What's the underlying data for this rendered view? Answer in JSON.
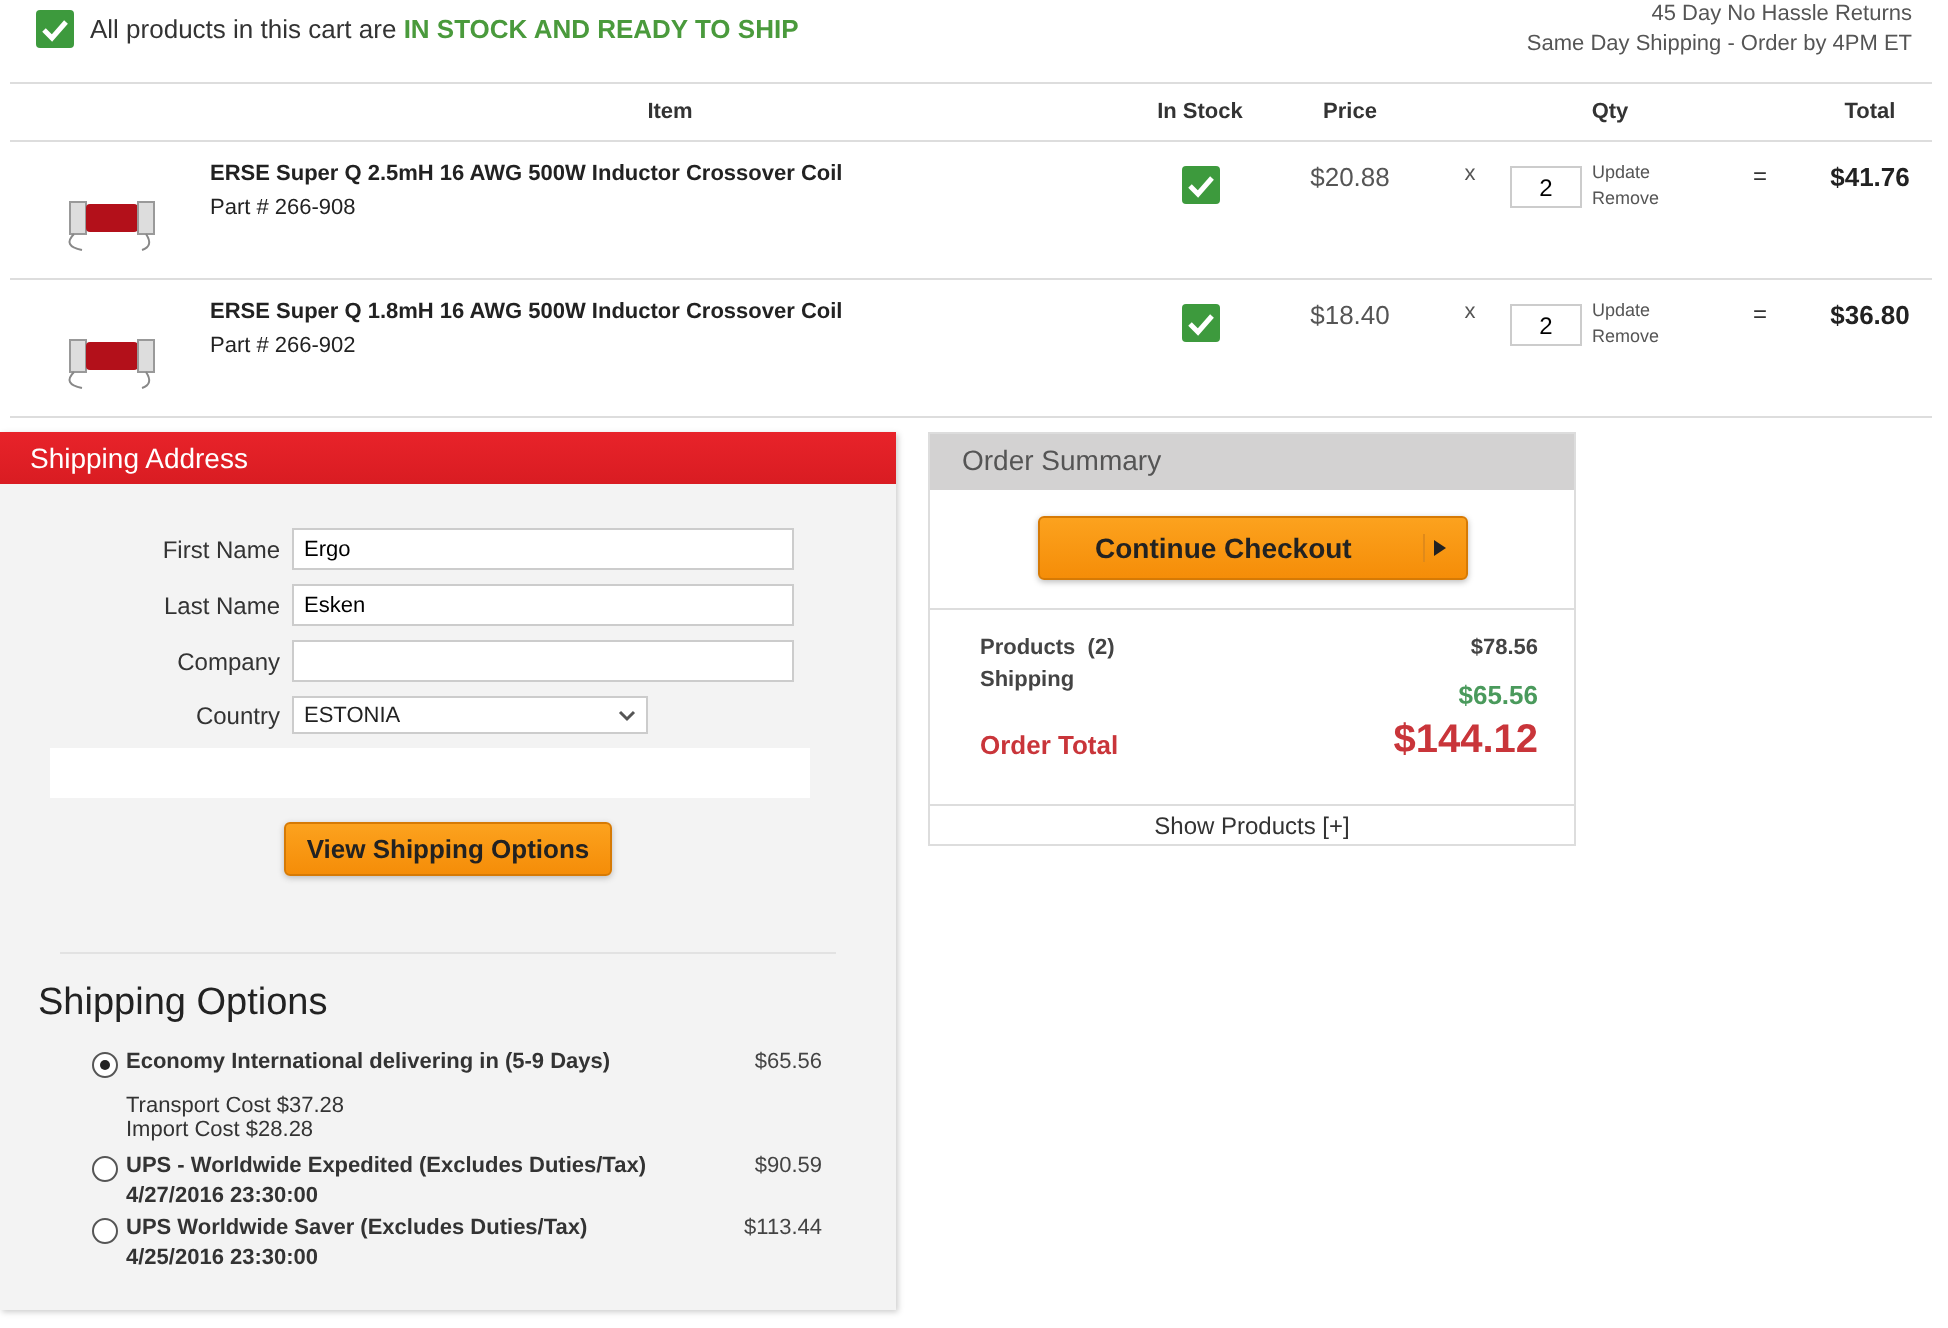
{
  "banner": {
    "checked": true,
    "text": "All products in this cart are",
    "highlight": "IN STOCK AND READY TO SHIP"
  },
  "notes": [
    "45 Day No Hassle Returns",
    "Same Day Shipping - Order by 4PM ET"
  ],
  "table": {
    "columns": [
      "Item",
      "In Stock",
      "Price",
      "Qty",
      "Total"
    ],
    "rows": [
      {
        "name": "ERSE Super Q 2.5mH 16 AWG 500W Inductor Crossover Coil",
        "part": "Part # 266-908",
        "in_stock": true,
        "price": "$20.88",
        "times": "x",
        "qty": "2",
        "actions": [
          "Update",
          "Remove"
        ],
        "equals": "=",
        "total": "$41.76"
      },
      {
        "name": "ERSE Super Q 1.8mH 16 AWG 500W Inductor Crossover Coil",
        "part": "Part # 266-902",
        "in_stock": true,
        "price": "$18.40",
        "times": "x",
        "qty": "2",
        "actions": [
          "Update",
          "Remove"
        ],
        "equals": "=",
        "total": "$36.80"
      }
    ]
  },
  "shipping_address": {
    "title": "Shipping Address",
    "fields": [
      {
        "label": "First Name",
        "value": "Ergo",
        "kind": "text"
      },
      {
        "label": "Last Name",
        "value": "Esken",
        "kind": "text"
      },
      {
        "label": "Company",
        "kind": "text"
      },
      {
        "label": "Country",
        "value": "ESTONIA",
        "kind": "select"
      }
    ],
    "button": "View Shipping Options"
  },
  "shipping_options": {
    "title": "Shipping Options",
    "options": [
      {
        "label": "Economy International delivering in (5-9 Days)",
        "price": "$65.56",
        "selected": true,
        "details": [
          "Transport Cost $37.28",
          "Import Cost $28.28"
        ]
      },
      {
        "label": "UPS - Worldwide Expedited (Excludes Duties/Tax)",
        "price": "$90.59",
        "selected": false,
        "date": "4/27/2016 23:30:00"
      },
      {
        "label": "UPS Worldwide Saver (Excludes Duties/Tax)",
        "price": "$113.44",
        "selected": false,
        "date": "4/25/2016 23:30:00"
      }
    ]
  },
  "order_summary": {
    "title": "Order Summary",
    "button": "Continue Checkout",
    "lines": [
      {
        "label": "Products  (2)",
        "value": "$78.56",
        "kind": "normal"
      },
      {
        "label": "Shipping",
        "value": "$65.56",
        "kind": "shipping"
      },
      {
        "label": "Order Total",
        "value": "$144.12",
        "kind": "total"
      }
    ],
    "footer": "Show Products [+]"
  }
}
